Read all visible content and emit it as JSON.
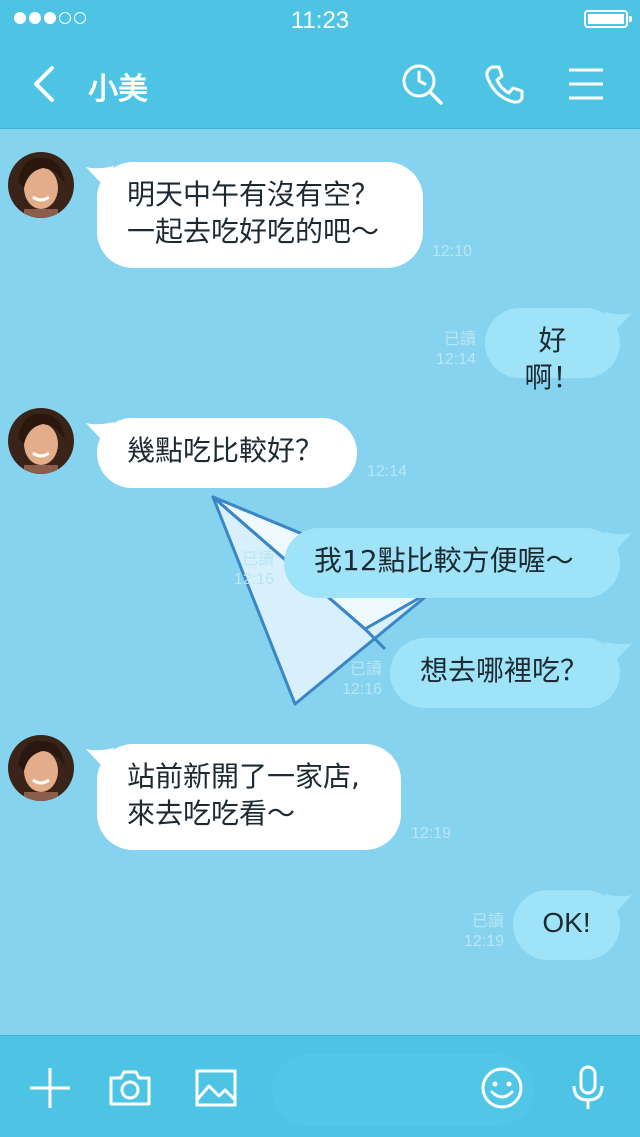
{
  "status": {
    "time": "11:23"
  },
  "header": {
    "contact_name": "小美"
  },
  "messages": [
    {
      "side": "in",
      "lines": [
        "明天中午有沒有空？",
        "一起去吃好吃的吧～"
      ],
      "time": "12:10"
    },
    {
      "side": "out",
      "text": "好啊！",
      "read": "已讀",
      "time": "12:14"
    },
    {
      "side": "in",
      "text": "幾點吃比較好？",
      "time": "12:14"
    },
    {
      "side": "out",
      "text": "我12點比較方便喔～",
      "read": "已讀",
      "time": "12:16"
    },
    {
      "side": "out",
      "text": "想去哪裡吃？",
      "read": "已讀",
      "time": "12:16"
    },
    {
      "side": "in",
      "lines": [
        "站前新開了一家店,",
        "來去吃吃看～"
      ],
      "time": "12:19"
    },
    {
      "side": "out",
      "text": "OK!",
      "read": "已讀",
      "time": "12:19"
    }
  ],
  "icons": {
    "header": [
      "back-icon",
      "search-icon",
      "phone-icon",
      "menu-icon"
    ],
    "input_bar": [
      "plus-icon",
      "camera-icon",
      "image-icon",
      "emoji-icon",
      "microphone-icon"
    ]
  },
  "colors": {
    "header": "#4ec4e4",
    "background": "#86d3ef",
    "incoming_bubble": "#ffffff",
    "outgoing_bubble": "#9ee3f7"
  }
}
